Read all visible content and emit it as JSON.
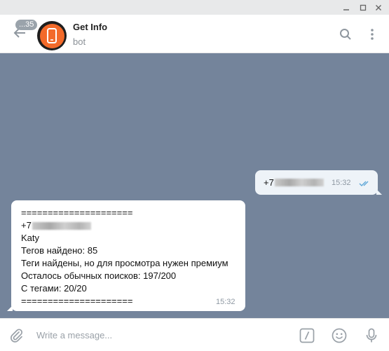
{
  "chat": {
    "title": "Get Info",
    "subtitle": "bot",
    "unread_badge": "...35"
  },
  "messages": {
    "outgoing": {
      "text_prefix": "+7",
      "time": "15:32",
      "status": "read"
    },
    "incoming": {
      "separator_top": "=====================",
      "phone_prefix": "+7",
      "name": "Katy",
      "tags_found": "Тегов найдено: 85",
      "premium_note": "Теги найдены, но для просмотра нужен премиум",
      "searches_left": "Осталось обычных поисков: 197/200",
      "with_tags": "С тегами: 20/20",
      "separator_bottom": "=====================",
      "time": "15:32"
    }
  },
  "composer": {
    "placeholder": "Write a message..."
  },
  "colors": {
    "chat_background": "#74849b",
    "accent": "#5ea7d8",
    "avatar": "#f36a2a"
  },
  "icons": [
    "back-arrow-icon",
    "search-icon",
    "more-vertical-icon",
    "attach-icon",
    "bot-command-icon",
    "emoji-icon",
    "microphone-icon",
    "double-check-icon",
    "phone-icon"
  ]
}
